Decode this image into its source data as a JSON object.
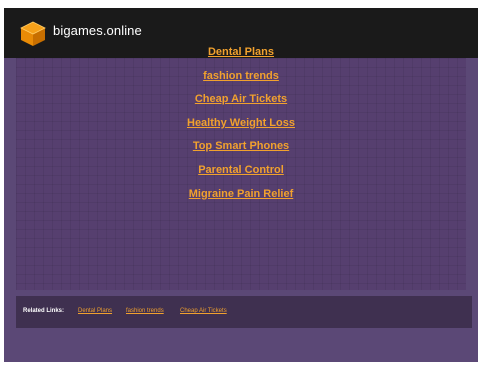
{
  "header": {
    "site_title": "bigames.online",
    "logo_icon": "orange-stacked-box-icon"
  },
  "main": {
    "links": [
      "Dental Plans",
      "fashion trends",
      "Cheap Air Tickets",
      "Healthy Weight Loss",
      "Top Smart Phones",
      "Parental Control",
      "Migraine Pain Relief"
    ]
  },
  "footer": {
    "label": "Related Links:",
    "links": [
      "Dental Plans",
      "fashion trends",
      "Cheap Air Tickets"
    ]
  },
  "colors": {
    "page_bg": "#ffffff",
    "frame_bg": "#5b4876",
    "header_bg": "#1a1a1a",
    "link_color": "#f1a12e",
    "footer_bg": "#3f3050"
  }
}
